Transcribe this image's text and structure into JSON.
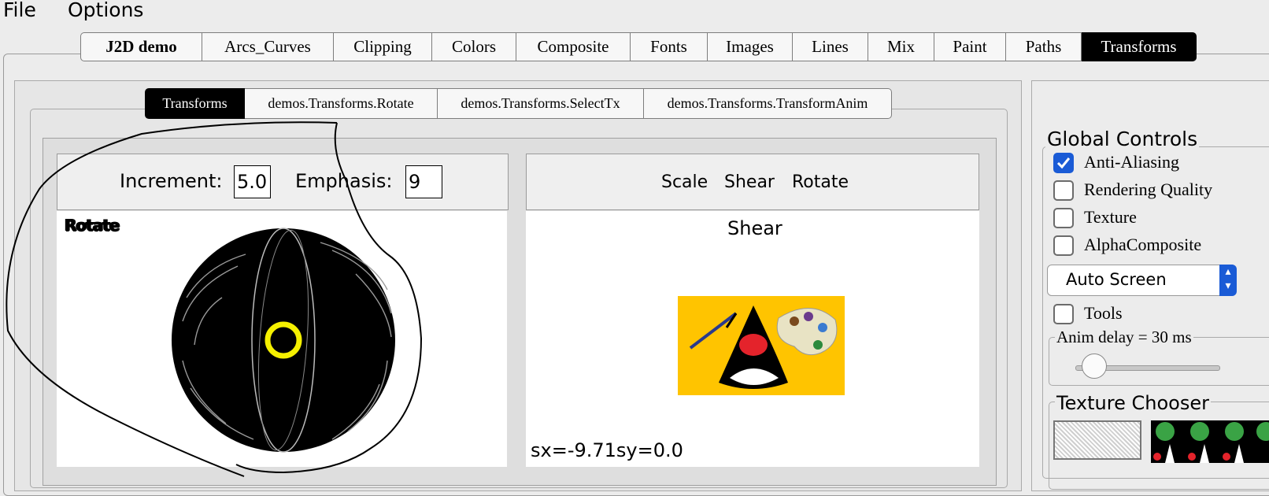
{
  "menubar": {
    "items": [
      "File",
      "Options"
    ]
  },
  "main_tabs": [
    "J2D demo",
    "Arcs_Curves",
    "Clipping",
    "Colors",
    "Composite",
    "Fonts",
    "Images",
    "Lines",
    "Mix",
    "Paint",
    "Paths",
    "Transforms"
  ],
  "main_selected": "Transforms",
  "sub_tabs": [
    "Transforms",
    "demos.Transforms.Rotate",
    "demos.Transforms.SelectTx",
    "demos.Transforms.TransformAnim"
  ],
  "sub_selected": "Transforms",
  "rotate_panel": {
    "increment_label": "Increment:",
    "increment_value": "5.0",
    "emphasis_label": "Emphasis:",
    "emphasis_value": "9",
    "canvas_label": "Rotate"
  },
  "selecttx_panel": {
    "links": [
      "Scale",
      "Shear",
      "Rotate"
    ],
    "mode_title": "Shear",
    "status": "sx=-9.71sy=0.0"
  },
  "global_controls": {
    "title": "Global Controls",
    "checkboxes": [
      {
        "label": "Anti-Aliasing",
        "checked": true
      },
      {
        "label": "Rendering Quality",
        "checked": false
      },
      {
        "label": "Texture",
        "checked": false
      },
      {
        "label": "AlphaComposite",
        "checked": false
      }
    ],
    "screen_select": "Auto Screen",
    "tools": {
      "label": "Tools",
      "checked": false
    },
    "anim_delay_label": "Anim delay = 30 ms",
    "anim_delay_value": 30,
    "texture_chooser_title": "Texture Chooser"
  },
  "colors": {
    "accent": "#1a5bd6",
    "selected_tab": "#000000",
    "ring": "#f5f000",
    "duke_bg": "#ffc400"
  }
}
